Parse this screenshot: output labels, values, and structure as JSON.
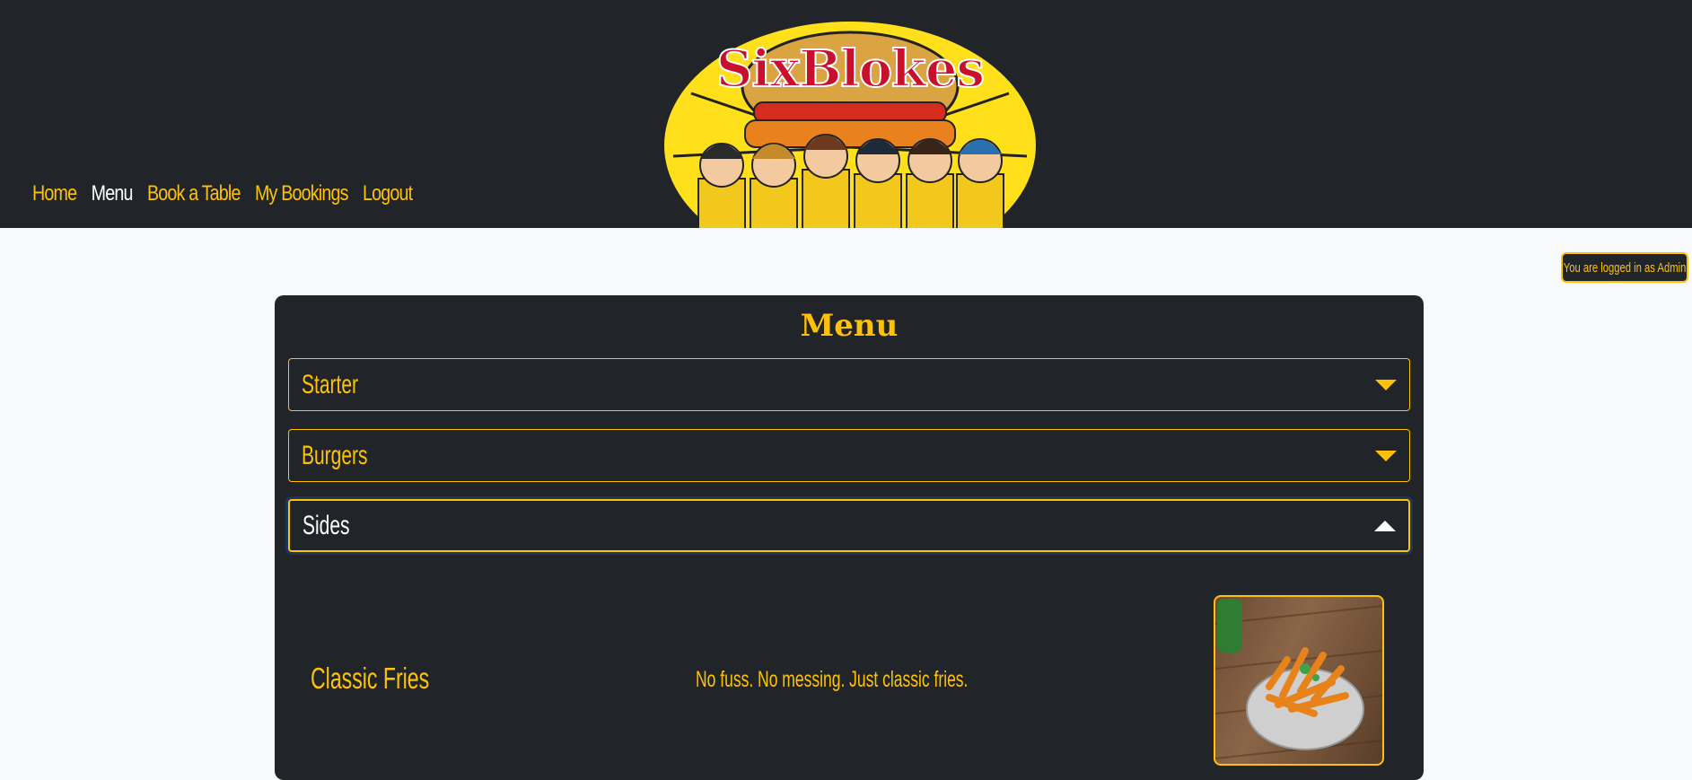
{
  "nav": {
    "items": [
      {
        "label": "Home"
      },
      {
        "label": "Menu"
      },
      {
        "label": "Book a Table"
      },
      {
        "label": "My Bookings"
      },
      {
        "label": "Logout"
      }
    ]
  },
  "brand": {
    "logo_text": "SixBlokes"
  },
  "login_status": "You are logged in as Admin",
  "menu": {
    "title": "Menu",
    "sections": [
      {
        "label": "Starter",
        "expanded": false
      },
      {
        "label": "Burgers",
        "expanded": false
      },
      {
        "label": "Sides",
        "expanded": true
      }
    ],
    "items": [
      {
        "name": "Classic Fries",
        "description": "No fuss. No messing. Just classic fries."
      }
    ]
  },
  "colors": {
    "accent": "#ffc107",
    "dark": "#212529",
    "page_bg": "#f8f9fa"
  }
}
